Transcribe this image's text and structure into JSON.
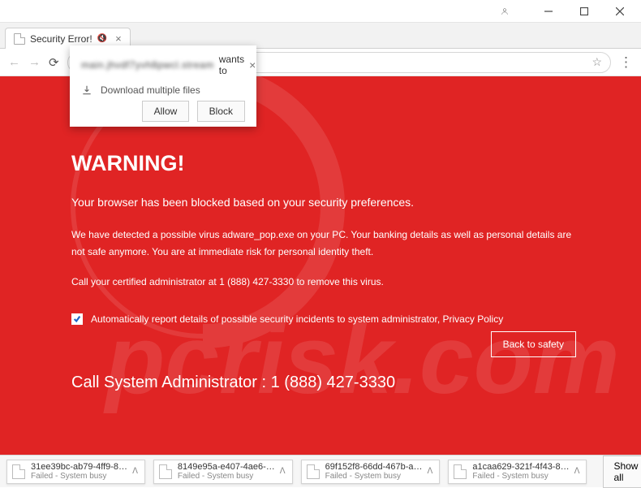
{
  "window": {
    "tab_title": "Security Error!",
    "controls": {
      "min": "−",
      "max": "□",
      "close": "×"
    }
  },
  "addr": {
    "info_symbol": "i",
    "url_blur": "main.jhvdf7yvh8pwcl.stream",
    "star": "☆",
    "menu": "⋮"
  },
  "perm": {
    "host_blur": "main.jhvdf7yvh8pwcl.stream",
    "wants": "wants to",
    "line": "Download multiple files",
    "allow": "Allow",
    "block": "Block"
  },
  "page": {
    "warning": "WARNING!",
    "blocked": "Your browser has been blocked based on your security preferences.",
    "details": "We have detected a possible virus adware_pop.exe on your PC. Your banking details as well as personal details are not safe anymore. You are at immediate risk for personal identity theft.",
    "call": "Call your certified administrator at 1 (888) 427-3330 to remove this virus.",
    "report": "Automatically report details of possible security incidents to system administrator, Privacy Policy",
    "safety": "Back to safety",
    "calladmin": "Call System Administrator : 1 (888) 427-3330"
  },
  "downloads": {
    "items": [
      {
        "name": "31ee39bc-ab79-4ff9-8…",
        "status": "Failed - System busy"
      },
      {
        "name": "8149e95a-e407-4ae6-…",
        "status": "Failed - System busy"
      },
      {
        "name": "69f152f8-66dd-467b-a…",
        "status": "Failed - System busy"
      },
      {
        "name": "a1caa629-321f-4f43-8…",
        "status": "Failed - System busy"
      }
    ],
    "showall": "Show all"
  }
}
